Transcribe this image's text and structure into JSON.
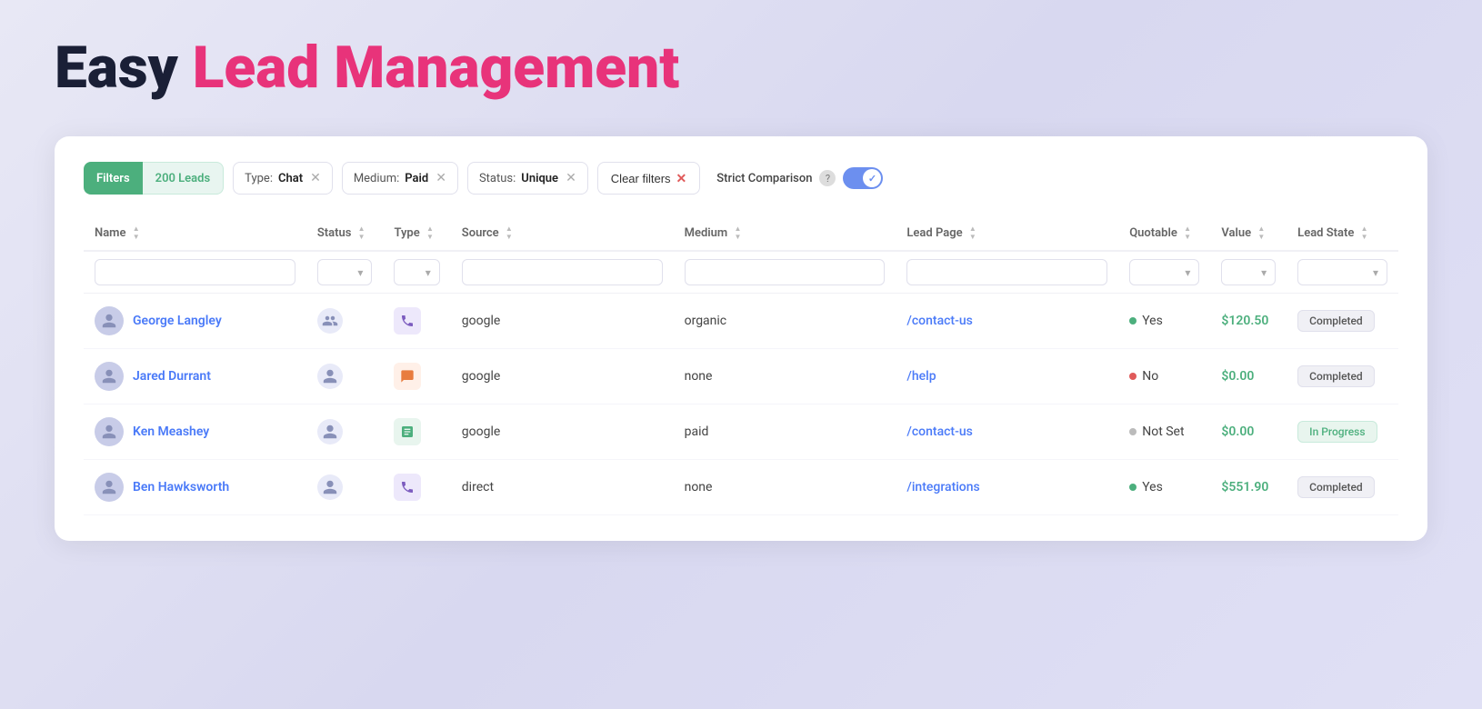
{
  "header": {
    "title_easy": "Easy",
    "title_rest": " Lead Management"
  },
  "filters": {
    "label": "Filters",
    "count": "200 Leads",
    "chips": [
      {
        "label": "Type:",
        "value": "Chat",
        "id": "type-chip"
      },
      {
        "label": "Medium:",
        "value": "Paid",
        "id": "medium-chip"
      },
      {
        "label": "Status:",
        "value": "Unique",
        "id": "status-chip"
      }
    ],
    "clear_label": "Clear filters",
    "strict_label": "Strict Comparison"
  },
  "table": {
    "columns": [
      "Name",
      "Status",
      "Type",
      "Source",
      "Medium",
      "Lead Page",
      "Quotable",
      "Value",
      "Lead State"
    ],
    "rows": [
      {
        "name": "George Langley",
        "status_icon": "users",
        "type_icon": "phone",
        "source": "google",
        "medium": "organic",
        "lead_page": "/contact-us",
        "quotable": "Yes",
        "quotable_dot": "green",
        "value": "$120.50",
        "state": "Completed",
        "state_type": "completed"
      },
      {
        "name": "Jared Durrant",
        "status_icon": "user",
        "type_icon": "chat",
        "source": "google",
        "medium": "none",
        "lead_page": "/help",
        "quotable": "No",
        "quotable_dot": "red",
        "value": "$0.00",
        "state": "Completed",
        "state_type": "completed"
      },
      {
        "name": "Ken Meashey",
        "status_icon": "user",
        "type_icon": "form",
        "source": "google",
        "medium": "paid",
        "lead_page": "/contact-us",
        "quotable": "Not Set",
        "quotable_dot": "gray",
        "value": "$0.00",
        "state": "In Progress",
        "state_type": "in-progress"
      },
      {
        "name": "Ben Hawksworth",
        "status_icon": "user",
        "type_icon": "phone",
        "source": "direct",
        "medium": "none",
        "lead_page": "/integrations",
        "quotable": "Yes",
        "quotable_dot": "green",
        "value": "$551.90",
        "state": "Completed",
        "state_type": "completed"
      }
    ]
  }
}
